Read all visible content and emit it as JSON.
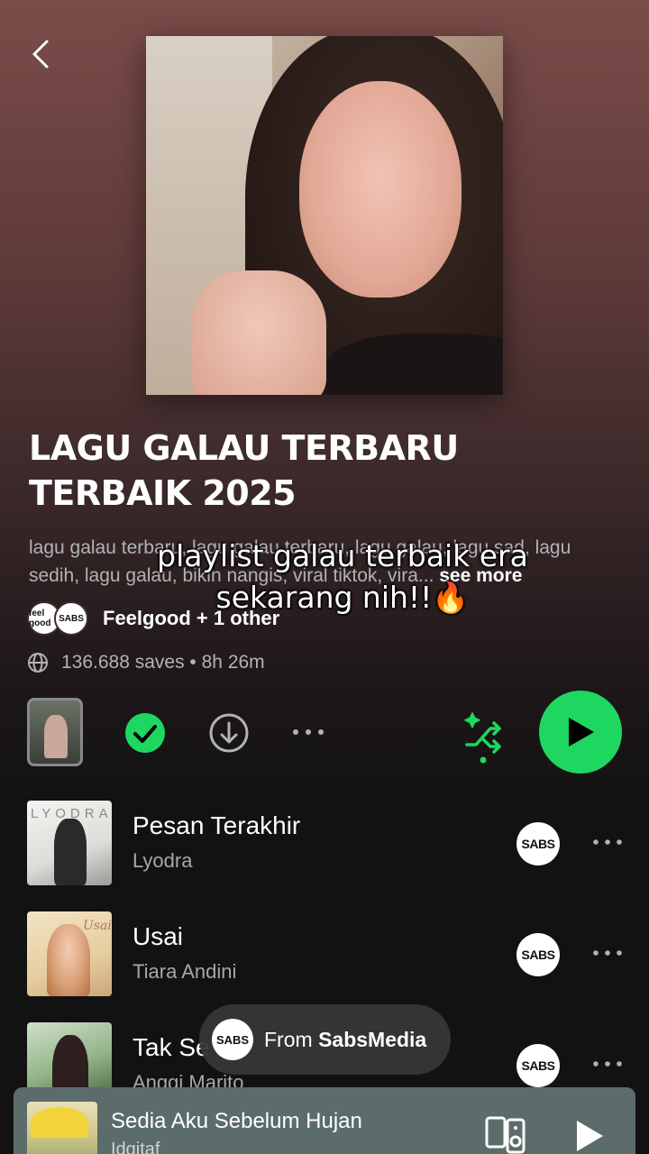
{
  "playlist": {
    "title_line1": "LAGU GALAU  TERBARU",
    "title_line2": "TERBAIK 2025",
    "description_line1": "lagu galau terbaru, lagu galau terbaru, lagu galau, lagu sad, lagu",
    "description_line2": "sedih, lagu galau,  bikin nangis, viral tiktok, vira...",
    "see_more": "see more",
    "creators": "Feelgood + 1 other",
    "creator_avatars": [
      "feel good",
      "SABS"
    ],
    "meta": "136.688 saves • 8h 26m"
  },
  "overlay_caption": {
    "line1": "playlist galau terbaik era",
    "line2": "sekarang nih!!🔥"
  },
  "icons": {
    "back": "chevron-left-icon",
    "globe": "globe-icon",
    "saved": "check-circle-icon",
    "download": "download-icon",
    "more": "more-horizontal-icon",
    "smart_shuffle": "smart-shuffle-icon",
    "play": "play-icon",
    "connect": "connect-device-icon"
  },
  "colors": {
    "accent": "#1ed760",
    "secondary_text": "#b3b3b3",
    "background": "#121212",
    "now_playing_bg": "#5b6c6a"
  },
  "tracks": [
    {
      "title": "Pesan Terakhir",
      "artist": "Lyodra",
      "art_text": "LYODRA",
      "badge": "SABS"
    },
    {
      "title": "Usai",
      "artist": "Tiara Andini",
      "art_text": "Usai",
      "badge": "SABS"
    },
    {
      "title": "Tak Se",
      "artist": "Anggi Marito",
      "art_text": "",
      "badge": "SABS"
    }
  ],
  "toast": {
    "badge": "SABS",
    "prefix": "From ",
    "source": "SabsMedia"
  },
  "now_playing": {
    "title": "Sedia Aku Sebelum Hujan",
    "artist": "Idgitaf"
  }
}
